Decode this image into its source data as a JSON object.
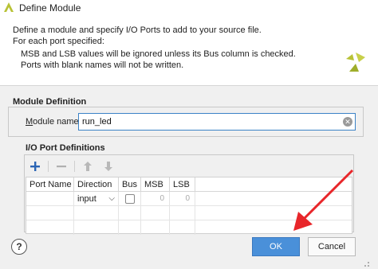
{
  "window": {
    "title": "Define Module"
  },
  "banner": {
    "lines": [
      "Define a module and specify I/O Ports to add to your source file.",
      "For each port specified:",
      "MSB and LSB values will be ignored unless its Bus column is checked.",
      "Ports with blank names will not be written."
    ]
  },
  "module_definition": {
    "heading": "Module Definition",
    "module_name_label": "Module name:",
    "module_name_value": "run_led"
  },
  "io_ports": {
    "heading": "I/O Port Definitions",
    "toolbar": {
      "add": "+",
      "remove": "−",
      "move_up": "⬆",
      "move_down": "⬇"
    },
    "columns": [
      "Port Name",
      "Direction",
      "Bus",
      "MSB",
      "LSB"
    ],
    "rows": [
      {
        "port_name": "",
        "direction": "input",
        "bus": false,
        "msb": "0",
        "lsb": "0"
      }
    ]
  },
  "buttons": {
    "help": "?",
    "ok": "OK",
    "cancel": "Cancel"
  },
  "colors": {
    "accent": "#4a90d9",
    "arrow": "#e8262a",
    "logo": "#b8c236"
  }
}
